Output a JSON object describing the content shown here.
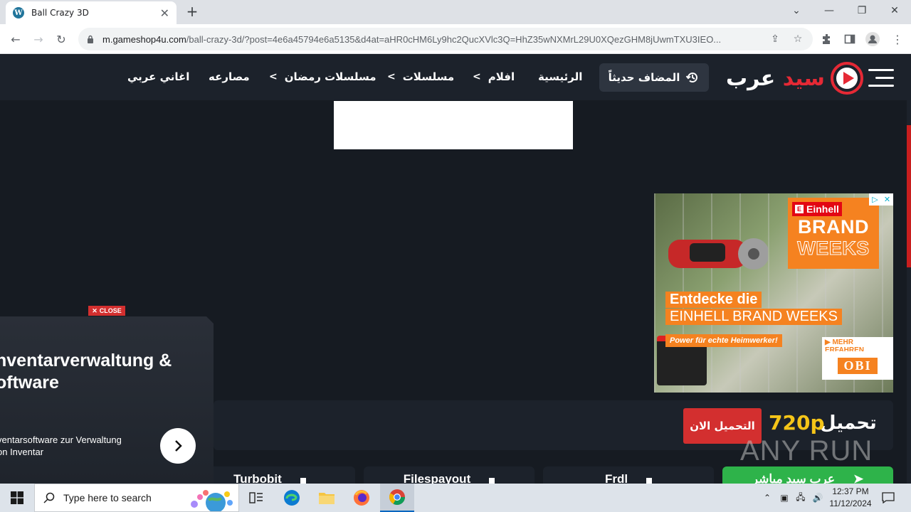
{
  "browser": {
    "tab_title": "Ball Crazy 3D",
    "tab_favicon_letter": "W",
    "new_tab_symbol": "+",
    "url_host": "m.gameshop4u.com",
    "url_path": "/ball-crazy-3d/?post=4e6a45794e6a5135&d4at=aHR0cHM6Ly9hc2QucXVlc3Q=HhZ35wNXMrL29U0XQezGHM8jUwmTXU3IEO..."
  },
  "site": {
    "logo_white": "عرب",
    "logo_red": "سيد",
    "recent_label": "المضاف حديثاً",
    "nav": [
      {
        "label": "الرئيسية"
      },
      {
        "label": "افلام"
      },
      {
        "label": "مسلسلات"
      },
      {
        "label": "مسلسلات رمضان"
      },
      {
        "label": "مصارعه"
      },
      {
        "label": "اغاني عربي"
      }
    ],
    "colors": {
      "accent": "#e52935",
      "nav_bg": "#1c222b",
      "page_bg": "#161b22",
      "gold": "#f5c518"
    }
  },
  "ad_right": {
    "brand": "Einhell",
    "brand_line1": "BRAND",
    "brand_line2": "WEEKS",
    "entdecke": "Entdecke die",
    "einhell_bw": "EINHELL BRAND WEEKS",
    "power": "Power für echte Heimwerker!",
    "mehr": "▶ MEHR ERFAHREN",
    "obi": "OBI"
  },
  "download": {
    "label": "تحميل",
    "quality": "720p",
    "button": "التحميل الان"
  },
  "servers": [
    {
      "name": "Turbobit"
    },
    {
      "name": "Filespayout"
    },
    {
      "name": "Frdl"
    },
    {
      "name": "عرب سيد مباشر"
    }
  ],
  "watermark": "ANY RUN",
  "bottom_ad": {
    "close": "CLOSE",
    "title_line1": "nventarverwaltung &",
    "title_line2": "oftware",
    "desc_line1": "ventarsoftware zur Verwaltung",
    "desc_line2": "on Inventar"
  },
  "taskbar": {
    "search_placeholder": "Type here to search",
    "time": "12:37 PM",
    "date": "11/12/2024"
  }
}
